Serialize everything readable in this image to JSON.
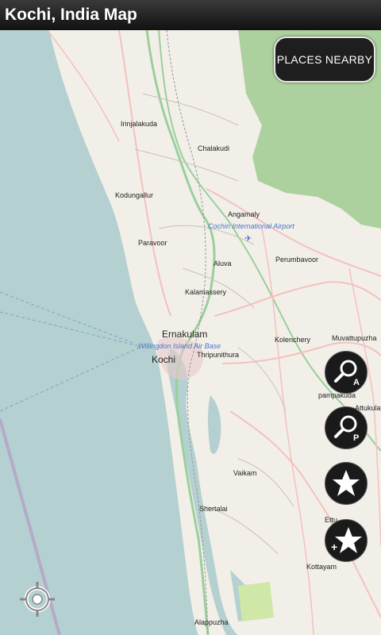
{
  "header": {
    "title": "Kochi, India Map"
  },
  "buttons": {
    "places_nearby": "PLACES NEARBY",
    "search_address": {
      "icon": "magnifier-icon",
      "badge": "A"
    },
    "search_place": {
      "icon": "magnifier-icon",
      "badge": "P"
    },
    "favorites": {
      "icon": "star-icon"
    },
    "add_favorite": {
      "icon": "star-add-icon",
      "badge": "+"
    },
    "my_location": {
      "icon": "crosshair-icon"
    }
  },
  "map": {
    "labels": {
      "irinjalakuda": "Irinjalakuda",
      "chalakudi": "Chalakudi",
      "kodungallur": "Kodungallur",
      "angamaly": "Angamaly",
      "airport": "Cochin International Airport",
      "paravoor": "Paravoor",
      "aluva": "Aluva",
      "perumbavoor": "Perumbavoor",
      "kalamassery": "Kalamassery",
      "ernakulam": "Ernakulam",
      "airbase": "Willingdon Island Air Base",
      "kochi": "Kochi",
      "thripunithura": "Thripunithura",
      "kolenchery": "Kolenchery",
      "muvattupuzha": "Muvattupuzha",
      "pampakuda": "pampakuda",
      "attukula": "Attukula",
      "vaikam": "Vaikam",
      "shertalai": "Shertalai",
      "ettu": "Ettu",
      "kottayam": "Kottayam",
      "alappuzha": "Alappuzha"
    },
    "colors": {
      "sea": "#b5d0d0",
      "land": "#f2efe9",
      "forest": "#add19e",
      "road": "#f4c0bd",
      "trunk": "#9bcf9b"
    }
  }
}
